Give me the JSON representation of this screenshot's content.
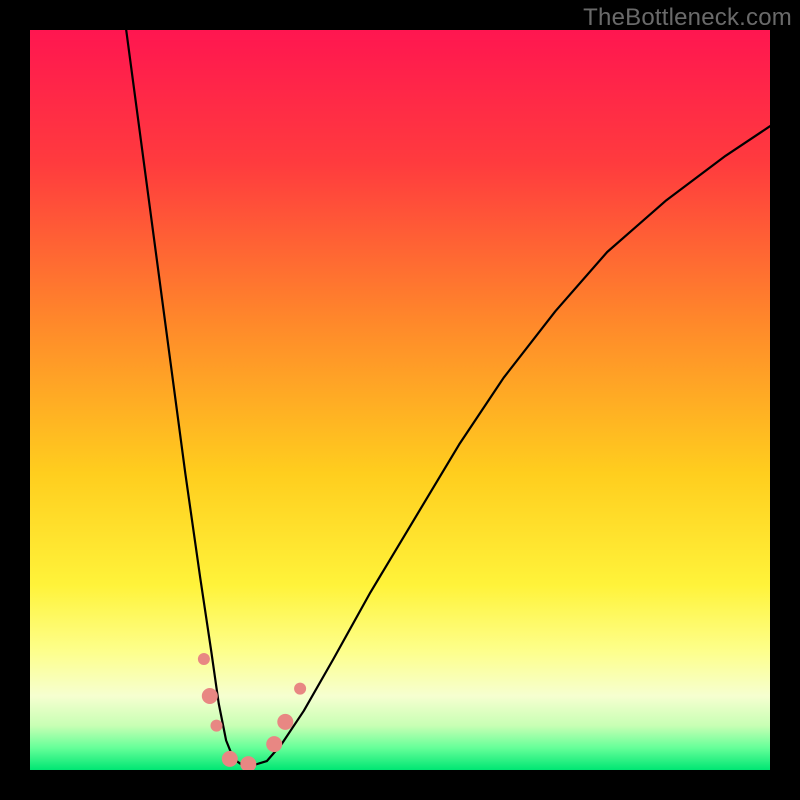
{
  "watermark": "TheBottleneck.com",
  "chart_data": {
    "type": "line",
    "title": "",
    "xlabel": "",
    "ylabel": "",
    "xlim": [
      0,
      100
    ],
    "ylim": [
      0,
      100
    ],
    "grid": false,
    "gradient_stops": [
      {
        "offset": 0,
        "color": "#ff1650"
      },
      {
        "offset": 18,
        "color": "#ff3b3e"
      },
      {
        "offset": 40,
        "color": "#ff8a2a"
      },
      {
        "offset": 60,
        "color": "#ffce1e"
      },
      {
        "offset": 75,
        "color": "#fff33a"
      },
      {
        "offset": 84,
        "color": "#fdff8c"
      },
      {
        "offset": 90,
        "color": "#f6ffd0"
      },
      {
        "offset": 94,
        "color": "#c8ffb4"
      },
      {
        "offset": 97,
        "color": "#66ff99"
      },
      {
        "offset": 100,
        "color": "#00e673"
      }
    ],
    "series": [
      {
        "name": "bottleneck-curve",
        "color": "#000000",
        "stroke_width": 2.2,
        "x": [
          13,
          15,
          17,
          19,
          21,
          23,
          24.5,
          25.5,
          26.5,
          27.5,
          28.5,
          30,
          32,
          34,
          37,
          41,
          46,
          52,
          58,
          64,
          71,
          78,
          86,
          94,
          100
        ],
        "y": [
          100,
          85,
          70,
          55,
          40,
          26,
          16,
          9,
          4,
          1.5,
          0.8,
          0.6,
          1.2,
          3.5,
          8,
          15,
          24,
          34,
          44,
          53,
          62,
          70,
          77,
          83,
          87
        ]
      }
    ],
    "markers": [
      {
        "name": "point-a",
        "x": 23.5,
        "y": 15,
        "r": 6,
        "color": "#e88783"
      },
      {
        "name": "point-b",
        "x": 24.3,
        "y": 10,
        "r": 8,
        "color": "#e88783"
      },
      {
        "name": "point-c",
        "x": 25.2,
        "y": 6,
        "r": 6,
        "color": "#e88783"
      },
      {
        "name": "point-d",
        "x": 27.0,
        "y": 1.5,
        "r": 8,
        "color": "#e88783"
      },
      {
        "name": "point-e",
        "x": 29.5,
        "y": 0.8,
        "r": 8,
        "color": "#e88783"
      },
      {
        "name": "point-f",
        "x": 33.0,
        "y": 3.5,
        "r": 8,
        "color": "#e88783"
      },
      {
        "name": "point-g",
        "x": 34.5,
        "y": 6.5,
        "r": 8,
        "color": "#e88783"
      },
      {
        "name": "point-h",
        "x": 36.5,
        "y": 11,
        "r": 6,
        "color": "#e88783"
      }
    ]
  }
}
